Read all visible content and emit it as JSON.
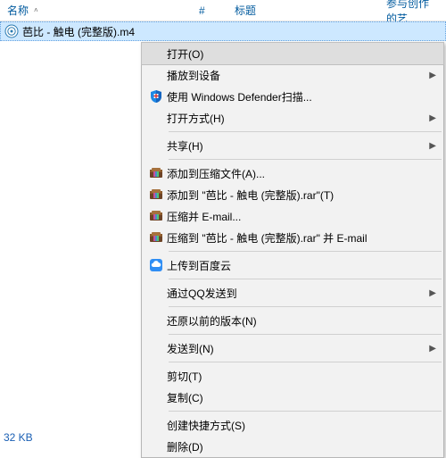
{
  "header": {
    "col_name": "名称",
    "col_num": "#",
    "col_title": "标题",
    "col_artist": "参与创作的艺"
  },
  "file": {
    "name": "芭比 - 触电 (完整版).m4"
  },
  "status": {
    "size": "32 KB"
  },
  "ctx": {
    "open": "打开(O)",
    "cast": "播放到设备",
    "defender": "使用 Windows Defender扫描...",
    "open_with": "打开方式(H)",
    "share": "共享(H)",
    "rar_add": "添加到压缩文件(A)...",
    "rar_add_named": "添加到 \"芭比 - 触电 (完整版).rar\"(T)",
    "rar_email": "压缩并 E-mail...",
    "rar_email_named": "压缩到 \"芭比 - 触电 (完整版).rar\" 并 E-mail",
    "baidu": "上传到百度云",
    "qq": "通过QQ发送到",
    "restore": "还原以前的版本(N)",
    "send_to": "发送到(N)",
    "cut": "剪切(T)",
    "copy": "复制(C)",
    "shortcut": "创建快捷方式(S)",
    "delete": "删除(D)"
  }
}
